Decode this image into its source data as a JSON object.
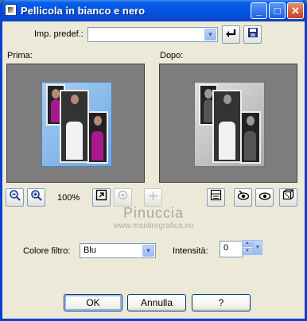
{
  "window": {
    "title": "Pellicola in bianco e nero"
  },
  "titlebar": {
    "minimize": "_",
    "maximize": "□",
    "close": "✕"
  },
  "presets": {
    "label": "Imp. predef.:",
    "value": ""
  },
  "preview": {
    "before_label": "Prima:",
    "after_label": "Dopo:",
    "zoom": "100%"
  },
  "watermark": {
    "name": "Pinuccia",
    "url": "www.maidiregrafica.eu"
  },
  "filter": {
    "label": "Colore filtro:",
    "value": "Blu"
  },
  "intensity": {
    "label": "Intensità:",
    "value": "0"
  },
  "buttons": {
    "ok": "OK",
    "cancel": "Annulla",
    "help": "?"
  },
  "icons": [
    "zoom-out-icon",
    "zoom-in-icon",
    "fit-window-icon",
    "navigate-icon",
    "pan-icon",
    "toggle-preview-icon",
    "proof-icon",
    "eye-icon",
    "randomize-icon",
    "reset-icon",
    "save-icon"
  ]
}
